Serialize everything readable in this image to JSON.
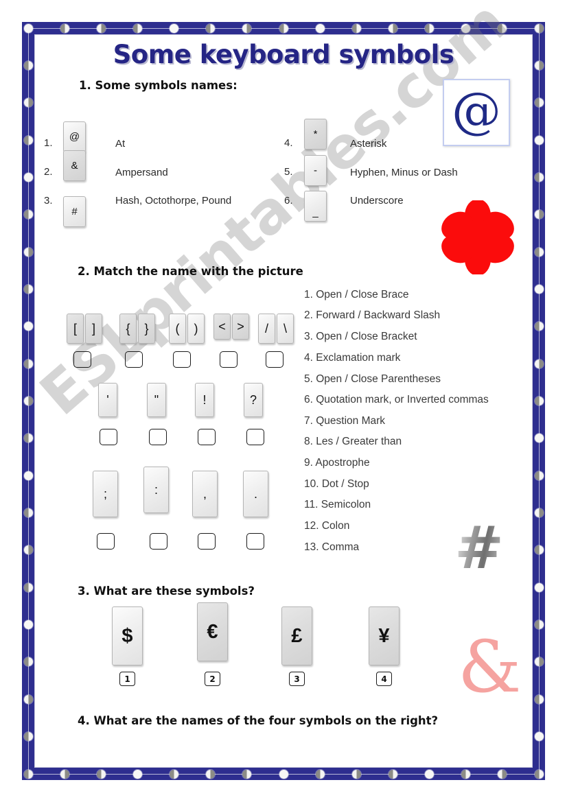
{
  "page": {
    "title": "Some keyboard symbols",
    "watermark": "ESLprintables.com",
    "accent_color": "#252585",
    "border_color": "#2e2e8f"
  },
  "section1": {
    "heading": "1. Some symbols names:",
    "left_items": [
      {
        "num": "1.",
        "key": "@",
        "name": "At"
      },
      {
        "num": "2.",
        "key": "&",
        "name": "Ampersand"
      },
      {
        "num": "3.",
        "key": "#",
        "name": "Hash, Octothorpe, Pound"
      }
    ],
    "right_items": [
      {
        "num": "4.",
        "key": "*",
        "name": "Asterisk"
      },
      {
        "num": "5.",
        "key": "-",
        "name": "Hyphen, Minus or Dash"
      },
      {
        "num": "6.",
        "key": "_",
        "name": "Underscore"
      }
    ],
    "clipart_at": "@"
  },
  "section2": {
    "heading": "2. Match the name with the picture",
    "names": [
      "1. Open / Close Brace",
      "2. Forward / Backward Slash",
      "3. Open / Close Bracket",
      "4. Exclamation mark",
      "5. Open / Close Parentheses",
      "6. Quotation mark, or Inverted commas",
      "7. Question Mark",
      "8. Les / Greater than",
      "9. Apostrophe",
      "10. Dot / Stop",
      "11. Semicolon",
      "12. Colon",
      "13. Comma"
    ],
    "row1_pairs": [
      {
        "open": "[",
        "close": "]"
      },
      {
        "open": "{",
        "close": "}"
      },
      {
        "open": "(",
        "close": ")"
      },
      {
        "open": "<",
        "close": ">"
      },
      {
        "open": "/",
        "close": "\\"
      }
    ],
    "row2_keys": [
      "'",
      "\"",
      "!",
      "?"
    ],
    "row3_keys": [
      ";",
      ":",
      ",",
      "."
    ],
    "answer_boxes_row1": [
      "",
      "",
      "",
      "",
      ""
    ],
    "answer_boxes_row2": [
      "",
      "",
      "",
      ""
    ],
    "answer_boxes_row3": [
      "",
      "",
      "",
      ""
    ],
    "clipart_asterisk": "*",
    "clipart_hash": "#"
  },
  "section3": {
    "heading": "3. What are these symbols?",
    "keys": [
      {
        "symbol": "$",
        "label": "1"
      },
      {
        "symbol": "€",
        "label": "2"
      },
      {
        "symbol": "£",
        "label": "3"
      },
      {
        "symbol": "¥",
        "label": "4"
      }
    ]
  },
  "section4": {
    "heading": "4. What are the names of the four symbols on the right?",
    "clipart_ampersand": "&"
  }
}
